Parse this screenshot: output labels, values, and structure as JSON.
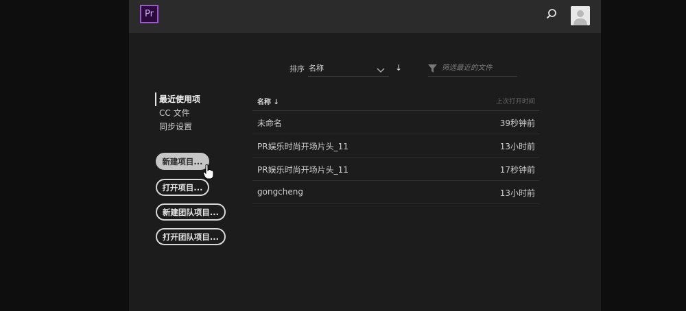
{
  "header": {
    "app_logo_text": "Pr"
  },
  "sort": {
    "label": "排序",
    "value": "名称",
    "direction_glyph": "↓",
    "filter_placeholder": "筛选最近的文件"
  },
  "sidebar": {
    "items": [
      {
        "label": "最近使用项",
        "active": true
      },
      {
        "label": "CC 文件",
        "active": false
      },
      {
        "label": "同步设置",
        "active": false
      }
    ]
  },
  "actions": {
    "new_project": "新建项目...",
    "open_project": "打开项目...",
    "new_team_project": "新建团队项目...",
    "open_team_project": "打开团队项目..."
  },
  "table": {
    "col_name": "名称",
    "col_name_sort_glyph": "↓",
    "col_time": "上次打开时间",
    "rows": [
      {
        "name": "未命名",
        "time": "39秒钟前"
      },
      {
        "name": "PR娱乐时尚开场片头_11",
        "time": "13小时前"
      },
      {
        "name": "PR娱乐时尚开场片头_11",
        "time": "17秒钟前"
      },
      {
        "name": "gongcheng",
        "time": "13小时前"
      }
    ]
  },
  "colors": {
    "accent_purple": "#9b59d0",
    "panel_bg": "#1c1c1c",
    "topbar_bg": "#2b2b2b"
  }
}
